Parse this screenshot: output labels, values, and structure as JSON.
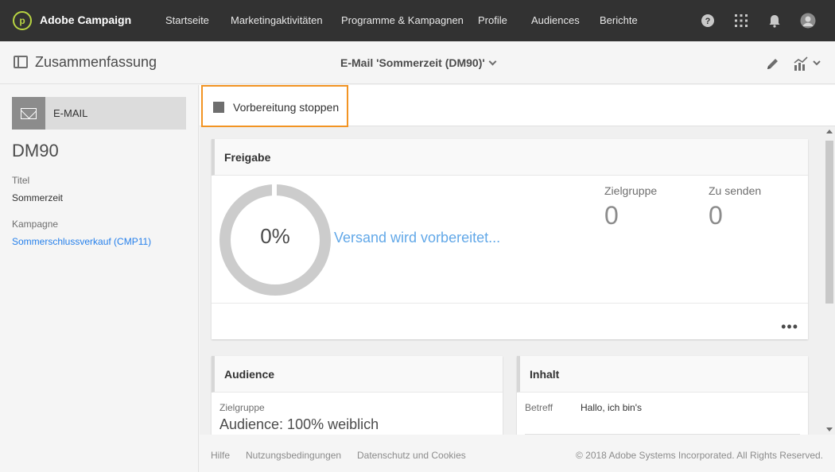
{
  "app": {
    "brand": "Adobe Campaign",
    "logo_glyph": "p"
  },
  "nav": {
    "items": [
      "Startseite",
      "Marketingaktivitäten",
      "Programme & Kampagnen",
      "Profile",
      "Audiences",
      "Berichte"
    ]
  },
  "nav_icons": {
    "help": "?",
    "apps": "⋮⋮⋮",
    "notifications": "🔔"
  },
  "subheader": {
    "summary_title": "Zusammenfassung",
    "delivery_title": "E-Mail 'Sommerzeit (DM90)'"
  },
  "left": {
    "channel_label": "E-MAIL",
    "code": "DM90",
    "title_label": "Titel",
    "title_value": "Sommerzeit",
    "campaign_label": "Kampagne",
    "campaign_value": "Sommerschlussverkauf (CMP11)"
  },
  "actionbar": {
    "stop_label": "Vorbereitung stoppen"
  },
  "approval": {
    "header": "Freigabe",
    "percent": "0%",
    "progress": 0,
    "status_text": "Versand wird vorbereitet...",
    "target_label": "Zielgruppe",
    "target_value": "0",
    "tosend_label": "Zu senden",
    "tosend_value": "0",
    "more": "•••"
  },
  "audience_card": {
    "header": "Audience",
    "target_label": "Zielgruppe",
    "target_value": "Audience: 100% weiblich"
  },
  "content_card": {
    "header": "Inhalt",
    "subject_label": "Betreff",
    "subject_value": "Hallo, ich bin's"
  },
  "footer": {
    "links": [
      "Hilfe",
      "Nutzungsbedingungen",
      "Datenschutz und Cookies"
    ],
    "copyright": "© 2018 Adobe Systems Incorporated. All Rights Reserved."
  },
  "colors": {
    "topbar": "#323232",
    "accent_orange": "#f29423",
    "link_blue": "#2680eb",
    "status_blue": "#62a8e8",
    "logo_green": "#b8d442"
  }
}
